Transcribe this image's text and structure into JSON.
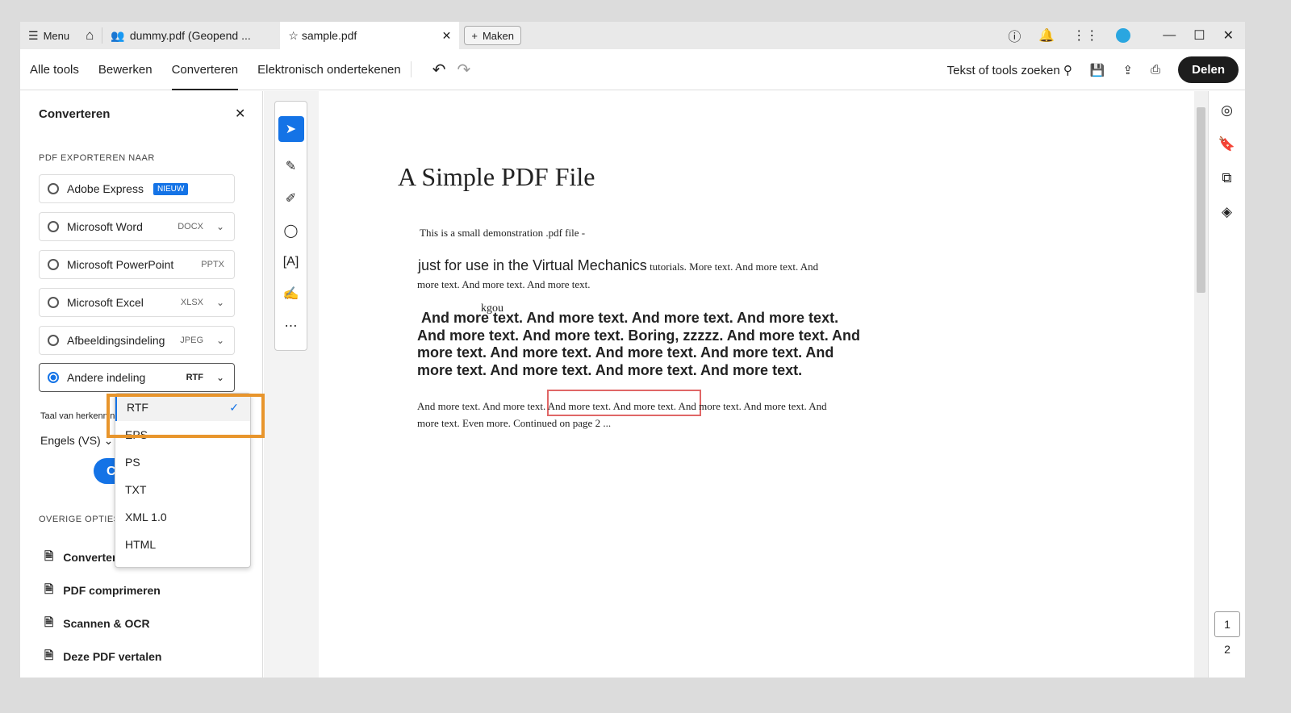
{
  "tabbar": {
    "menu": "Menu",
    "tab1": "dummy.pdf (Geopend ...",
    "tab2": "sample.pdf",
    "maken": "Maken"
  },
  "toolbar": {
    "tabs": [
      "Alle tools",
      "Bewerken",
      "Converteren",
      "Elektronisch ondertekenen"
    ],
    "search": "Tekst of tools zoeken",
    "share": "Delen"
  },
  "panel": {
    "title": "Converteren",
    "section": "PDF EXPORTEREN NAAR",
    "options": [
      {
        "label": "Adobe Express",
        "badge": "NIEUW"
      },
      {
        "label": "Microsoft Word",
        "fmt": "DOCX"
      },
      {
        "label": "Microsoft PowerPoint",
        "fmt": "PPTX"
      },
      {
        "label": "Microsoft Excel",
        "fmt": "XLSX"
      },
      {
        "label": "Afbeeldingsindeling",
        "fmt": "JPEG"
      },
      {
        "label": "Andere indeling",
        "fmt": "RTF"
      }
    ],
    "lang_label": "Taal van herkenning",
    "lang_value": "Engels (VS)",
    "convert_btn": "C",
    "other_section": "OVERIGE OPTIES",
    "other": [
      "Converteren",
      "PDF comprimeren",
      "Scannen & OCR",
      "Deze PDF vertalen"
    ]
  },
  "dropdown": {
    "items": [
      "RTF",
      "EPS",
      "PS",
      "TXT",
      "XML 1.0",
      "HTML"
    ],
    "selected": "RTF"
  },
  "doc": {
    "title": "A Simple PDF File",
    "line1": "This is a small demonstration .pdf file -",
    "line2a": "just for use in the Virtual Mechanics",
    "line2b": " tutorials. More text. And more  text. And",
    "line3": "more text. And more text. And more text.",
    "kgou": "kgou",
    "bold": [
      "And more text. And more text. And more text. And more text.",
      "And more  text. And more text. Boring, zzzzz. And more text. And",
      "more text. And  more text. And more text. And more text. And",
      "more text. And more text. And more text. And more text."
    ],
    "p3a": " And more text. And more text. And more text. And more text. And more  text. And more text. And",
    "p3b": "more text. Even more. Continued on page 2 ..."
  },
  "pages": {
    "current": "1",
    "next": "2"
  }
}
